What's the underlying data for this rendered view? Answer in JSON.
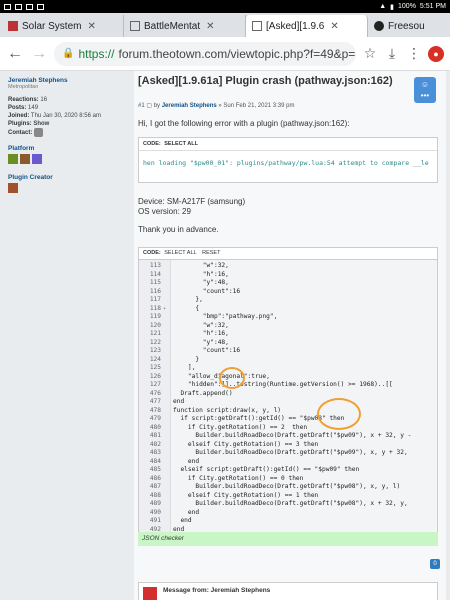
{
  "status_bar": {
    "left_icons": [
      "notification",
      "image",
      "email",
      "android"
    ],
    "right": "100%",
    "time": "5:51 PM"
  },
  "tabs": [
    {
      "label": "Solar System",
      "active": false
    },
    {
      "label": "BattleMentat",
      "active": false
    },
    {
      "label": "[Asked][1.9.6",
      "active": true
    },
    {
      "label": "Freesou",
      "active": false
    }
  ],
  "address_bar": {
    "scheme": "https://",
    "url": "forum.theotown.com/viewtopic.php?f=49&p=17"
  },
  "sidebar": {
    "username": "Jeremiah Stephens",
    "rank": "Metropolitan",
    "reactions_label": "Reactions:",
    "reactions_value": "16",
    "posts_label": "Posts:",
    "posts_value": "149",
    "joined_label": "Joined:",
    "joined_value": "Thu Jan 30, 2020 8:56 am",
    "plugins_label": "Plugins:",
    "plugins_value": "Show",
    "contact_label": "Contact:",
    "platform_label": "Platform",
    "plugin_creator_label": "Plugin Creator"
  },
  "post": {
    "title": "[Asked][1.9.61a] Plugin crash (pathway.json:162)",
    "meta_prefix": "#1",
    "meta_by": "by",
    "meta_author": "Jeremiah Stephens",
    "meta_date": "» Sun Feb 21, 2021 3:39 pm",
    "intro": "Hi, I got the following error with a plugin (pathway.json:162):",
    "code1_header": "CODE:",
    "code1_select": "SELECT ALL",
    "code1_line": "hen loading \"$pw00_01\": plugins/pathway/pw.lua:54 attempt to compare __le",
    "device": "Device: SM-A217F (samsung)",
    "os": "OS version: 29",
    "thanks": "Thank you in advance.",
    "code2_header": "CODE:",
    "code2_select": "SELECT ALL",
    "code2_reset": "RESET",
    "json_checker": "JSON checker",
    "badge": "0",
    "message_from": "Message from: Jeremiah Stephens"
  },
  "code_lines": [
    {
      "num": "113",
      "fold": "",
      "text": "        \"w\":32,"
    },
    {
      "num": "114",
      "fold": "",
      "text": "        \"h\":16,"
    },
    {
      "num": "115",
      "fold": "",
      "text": "        \"y\":48,"
    },
    {
      "num": "116",
      "fold": "",
      "text": "        \"count\":16"
    },
    {
      "num": "117",
      "fold": "",
      "text": "      },"
    },
    {
      "num": "118",
      "fold": "▾",
      "text": "      {"
    },
    {
      "num": "119",
      "fold": "",
      "text": "        \"bmp\":\"pathway.png\","
    },
    {
      "num": "120",
      "fold": "",
      "text": "        \"w\":32,"
    },
    {
      "num": "121",
      "fold": "",
      "text": "        \"h\":16,"
    },
    {
      "num": "122",
      "fold": "",
      "text": "        \"y\":48,"
    },
    {
      "num": "123",
      "fold": "",
      "text": "        \"count\":16"
    },
    {
      "num": "124",
      "fold": "",
      "text": "      }"
    },
    {
      "num": "125",
      "fold": "",
      "text": "    ],"
    },
    {
      "num": "126",
      "fold": "",
      "text": "    \"allow_diagonal\":true,"
    },
    {
      "num": "127",
      "fold": "",
      "text": "    \"hidden\":]]..tostring(Runtime.getVersion() >= 1968)..[[ "
    },
    {
      "num": "476",
      "fold": "",
      "text": "  Draft.append()"
    },
    {
      "num": "477",
      "fold": "",
      "text": "end"
    },
    {
      "num": "478",
      "fold": "",
      "text": "function script:draw(x, y, l)"
    },
    {
      "num": "479",
      "fold": "",
      "text": "  if script:getDraft():getId() == \"$pw08\" then"
    },
    {
      "num": "480",
      "fold": "",
      "text": "    if City.getRotation() == 2  then"
    },
    {
      "num": "481",
      "fold": "",
      "text": "      Builder.buildRoadDeco(Draft.getDraft(\"$pw09\"), x + 32, y -"
    },
    {
      "num": "482",
      "fold": "",
      "text": "    elseif City.getRotation() == 3 then"
    },
    {
      "num": "483",
      "fold": "",
      "text": "      Builder.buildRoadDeco(Draft.getDraft(\"$pw09\"), x, y + 32,"
    },
    {
      "num": "484",
      "fold": "",
      "text": "    end"
    },
    {
      "num": "485",
      "fold": "",
      "text": "  elseif script:getDraft():getId() == \"$pw09\" then"
    },
    {
      "num": "486",
      "fold": "",
      "text": "    if City.getRotation() == 0 then"
    },
    {
      "num": "487",
      "fold": "",
      "text": "      Builder.buildRoadDeco(Draft.getDraft(\"$pw08\"), x, y, l)"
    },
    {
      "num": "488",
      "fold": "",
      "text": "    elseif City.getRotation() == 1 then"
    },
    {
      "num": "489",
      "fold": "",
      "text": "      Builder.buildRoadDeco(Draft.getDraft(\"$pw08\"), x + 32, y,"
    },
    {
      "num": "490",
      "fold": "",
      "text": "    end"
    },
    {
      "num": "491",
      "fold": "",
      "text": "  end"
    },
    {
      "num": "492",
      "fold": "",
      "text": "end"
    },
    {
      "num": "493",
      "fold": "",
      "text": ""
    }
  ],
  "colors": {
    "link": "#105289",
    "json_checker_bg": "#c8f7c5",
    "annotation": "#f0a030"
  }
}
